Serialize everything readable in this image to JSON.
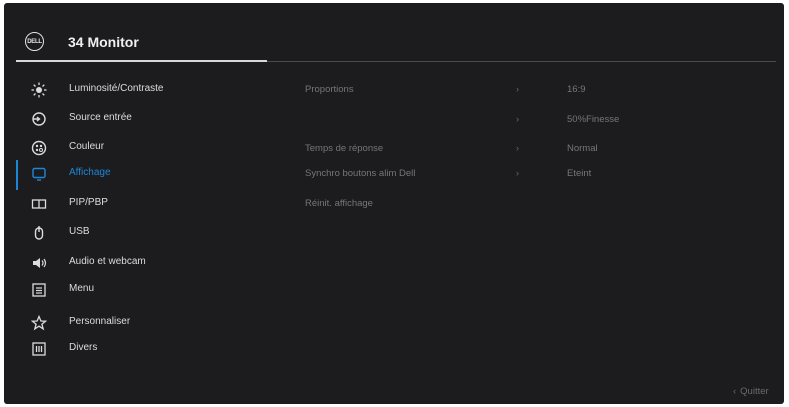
{
  "header": {
    "logo_text": "DELL",
    "title": "34 Monitor",
    "progress_fraction": 0.33
  },
  "sidebar": {
    "items": [
      {
        "label": "Luminosité/Contraste",
        "icon": "brightness-icon"
      },
      {
        "label": "Source entrée",
        "icon": "input-source-icon"
      },
      {
        "label": "Couleur",
        "icon": "color-palette-icon"
      },
      {
        "label": "Affichage",
        "icon": "display-icon",
        "active": true
      },
      {
        "label": "PIP/PBP",
        "icon": "pip-pbp-icon"
      },
      {
        "label": "USB",
        "icon": "usb-icon"
      },
      {
        "label": "Audio et webcam",
        "icon": "speaker-icon"
      },
      {
        "label": "Menu",
        "icon": "menu-icon"
      },
      {
        "label": "Personnaliser",
        "icon": "star-icon"
      },
      {
        "label": "Divers",
        "icon": "others-icon"
      }
    ]
  },
  "content": {
    "rows": [
      {
        "label": "Proportions",
        "chevron": "›",
        "value": "16:9"
      },
      {
        "label": "",
        "chevron": "›",
        "value": "50%Finesse"
      },
      {
        "label": "Temps de réponse",
        "chevron": "›",
        "value": "Normal"
      },
      {
        "label": "Synchro boutons alim Dell",
        "chevron": "›",
        "value": "Eteint"
      },
      {
        "label": "Réinit. affichage",
        "chevron": "",
        "value": ""
      }
    ]
  },
  "footer": {
    "quit_chevron": "‹",
    "quit_label": "Quitter"
  },
  "colors": {
    "background": "#1c1c1e",
    "accent": "#1e86d6",
    "text": "#dcdcdc",
    "dim_text": "#767676"
  }
}
